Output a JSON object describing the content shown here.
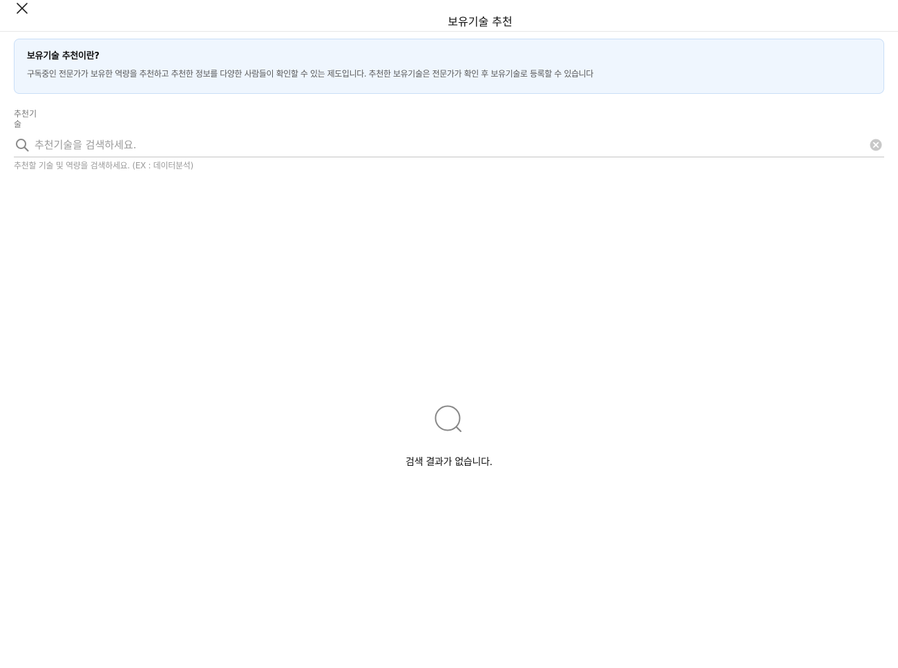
{
  "header": {
    "title": "보유기술 추천",
    "close_icon": "close-icon"
  },
  "info": {
    "title": "보유기술 추천이란?",
    "description": "구독중인 전문가가 보유한 역량을 추천하고 추천한 정보를 다양한 사람들이 확인할 수 있는 제도입니다. 추천한 보유기술은 전문가가 확인 후 보유기술로 등록할 수 있습니다"
  },
  "search": {
    "label": "추천기술",
    "placeholder": "추천기술을 검색하세요.",
    "value": "",
    "helper": "추천할 기술 및 역량을 검색하세요. (EX : 데이터분석)",
    "search_icon": "search-icon",
    "clear_icon": "clear-icon"
  },
  "empty": {
    "icon": "search-icon",
    "message": "검색 결과가 없습니다."
  },
  "colors": {
    "info_bg": "#eff6fe",
    "info_border": "#c9def7",
    "text_primary": "#111111",
    "text_muted": "#9a9a9a"
  }
}
